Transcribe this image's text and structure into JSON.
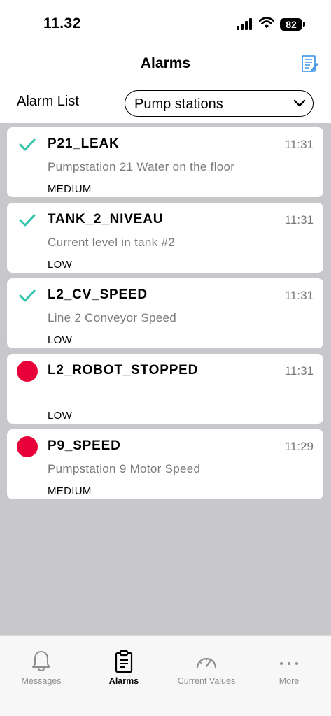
{
  "status_bar": {
    "time": "11.32",
    "battery": "82"
  },
  "header": {
    "title": "Alarms",
    "report_icon": "report-list-icon"
  },
  "filter": {
    "label": "Alarm List",
    "selected": "Pump stations"
  },
  "alarms": [
    {
      "name": "P21_LEAK",
      "time": "11:31",
      "description": "Pumpstation 21 Water on the floor",
      "priority": "MEDIUM",
      "status": "acknowledged"
    },
    {
      "name": "TANK_2_NIVEAU",
      "time": "11:31",
      "description": "Current level in tank #2",
      "priority": "LOW",
      "status": "acknowledged"
    },
    {
      "name": "L2_CV_SPEED",
      "time": "11:31",
      "description": "Line 2 Conveyor Speed",
      "priority": "LOW",
      "status": "acknowledged"
    },
    {
      "name": "L2_ROBOT_STOPPED",
      "time": "11:31",
      "description": "",
      "priority": "LOW",
      "status": "active"
    },
    {
      "name": "P9_SPEED",
      "time": "11:29",
      "description": "Pumpstation 9 Motor Speed",
      "priority": "MEDIUM",
      "status": "active"
    }
  ],
  "colors": {
    "acknowledged": "#2ec4a6",
    "active": "#e8003a",
    "list_background": "#c8c7cc"
  },
  "tabs": [
    {
      "label": "Messages",
      "icon": "bell-icon",
      "active": false
    },
    {
      "label": "Alarms",
      "icon": "clipboard-icon",
      "active": true
    },
    {
      "label": "Current Values",
      "icon": "gauge-icon",
      "active": false
    },
    {
      "label": "More",
      "icon": "more-dots-icon",
      "active": false
    }
  ]
}
